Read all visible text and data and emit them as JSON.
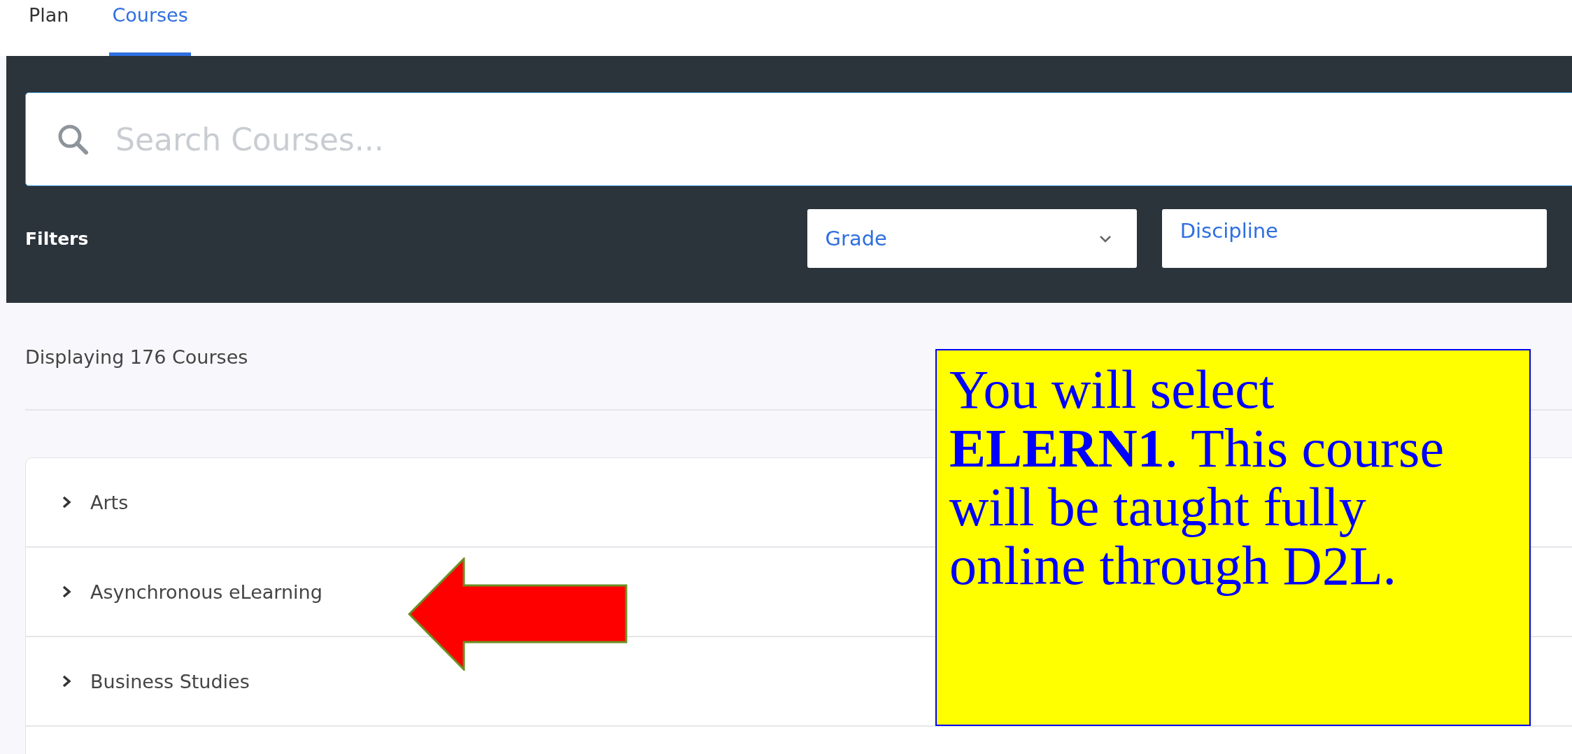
{
  "tabs": [
    {
      "label": "Plan",
      "selected": false
    },
    {
      "label": "Courses",
      "selected": true
    }
  ],
  "search": {
    "placeholder": "Search Courses..."
  },
  "filters": {
    "label": "Filters",
    "dropdowns": [
      {
        "label": "Grade",
        "kind": "chevron"
      },
      {
        "label": "Discipline",
        "kind": "plain"
      }
    ]
  },
  "result_count": "Displaying 176 Courses",
  "categories": [
    {
      "label": "Arts",
      "expanded": false
    },
    {
      "label": "Asynchronous eLearning",
      "expanded": false
    },
    {
      "label": "Business Studies",
      "expanded": false
    }
  ],
  "callout": {
    "text": "You will select **ELERN1**. This course will be taught fully online through D2L."
  }
}
